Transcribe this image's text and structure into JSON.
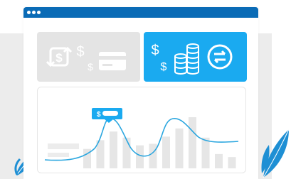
{
  "window": {
    "controls": [
      "close",
      "minimize",
      "maximize"
    ]
  },
  "colors": {
    "titlebar": "#0a6bb6",
    "accent": "#1aaaf0",
    "inactive_card": "#e4e4e4",
    "chart_line": "#2aa6df",
    "leaf": "#1e8fd4"
  },
  "cards": [
    {
      "state": "inactive",
      "icons": [
        "currency-exchange-icon",
        "dollar-signs-icon",
        "credit-card-icon"
      ]
    },
    {
      "state": "active",
      "icons": [
        "dollar-signs-icon",
        "coin-stack-icon",
        "transfer-arrows-icon"
      ]
    }
  ],
  "chart": {
    "tooltip_symbol": "$",
    "bar_heights_normalized": [
      0.38,
      0.55,
      0.72,
      0.6,
      0.45,
      0.48,
      0.62,
      0.78,
      1.0,
      0.6,
      0.28,
      0.22
    ]
  }
}
